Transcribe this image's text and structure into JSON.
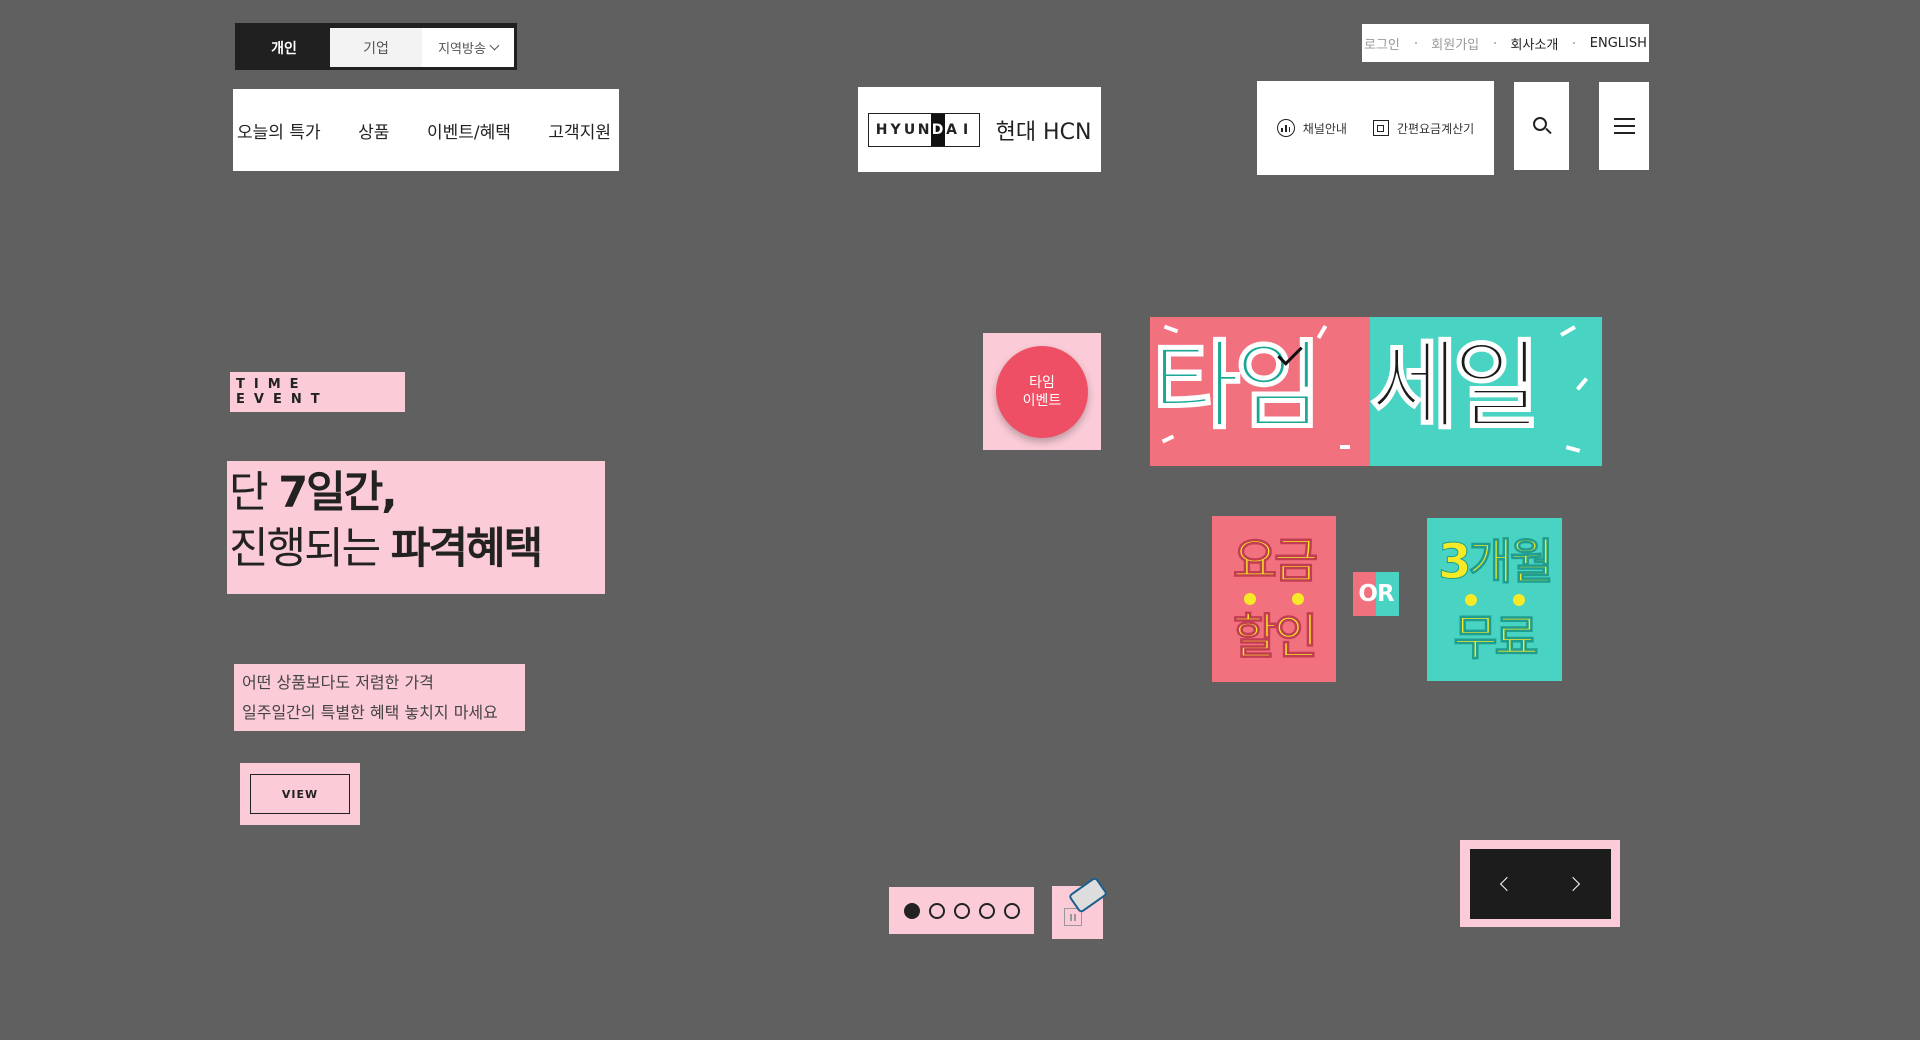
{
  "top_tabs": {
    "personal": "개인",
    "business": "기업",
    "regional": "지역방송"
  },
  "gnb": {
    "items": [
      "오늘의 특가",
      "상품",
      "이벤트/혜택",
      "고객지원"
    ]
  },
  "logo": {
    "letters": [
      "H",
      "Y",
      "U",
      "N",
      "D",
      "A",
      "I"
    ],
    "text": "현대 HCN"
  },
  "util": {
    "login": "로그인",
    "signup": "회원가입",
    "company": "회사소개",
    "english": "ENGLISH"
  },
  "quick": {
    "channel": "채널안내",
    "calculator": "간편요금계산기"
  },
  "hero": {
    "tag": "TIME EVENT",
    "headline_1a": "단 ",
    "headline_1b": "7일간,",
    "headline_2a": "진행되는 ",
    "headline_2b": "파격혜택",
    "desc_1": "어떤 상품보다도 저렴한 가격",
    "desc_2": "일주일간의 특별한 혜택 놓치지 마세요",
    "view": "VIEW"
  },
  "banner": {
    "badge_1": "타임",
    "badge_2": "이벤트",
    "sale_left": "타임",
    "sale_right": "세일",
    "tile1_top": "요금",
    "tile1_bottom": "할인",
    "or": "OR",
    "tile2_top": "3개월",
    "tile2_bottom": "무료"
  },
  "colors": {
    "background": "#606060",
    "highlight": "#fbccd7",
    "coral": "#f2717f",
    "mint": "#49d3c2",
    "yellow": "#f6ea26",
    "badge_red": "#ef4f64"
  }
}
